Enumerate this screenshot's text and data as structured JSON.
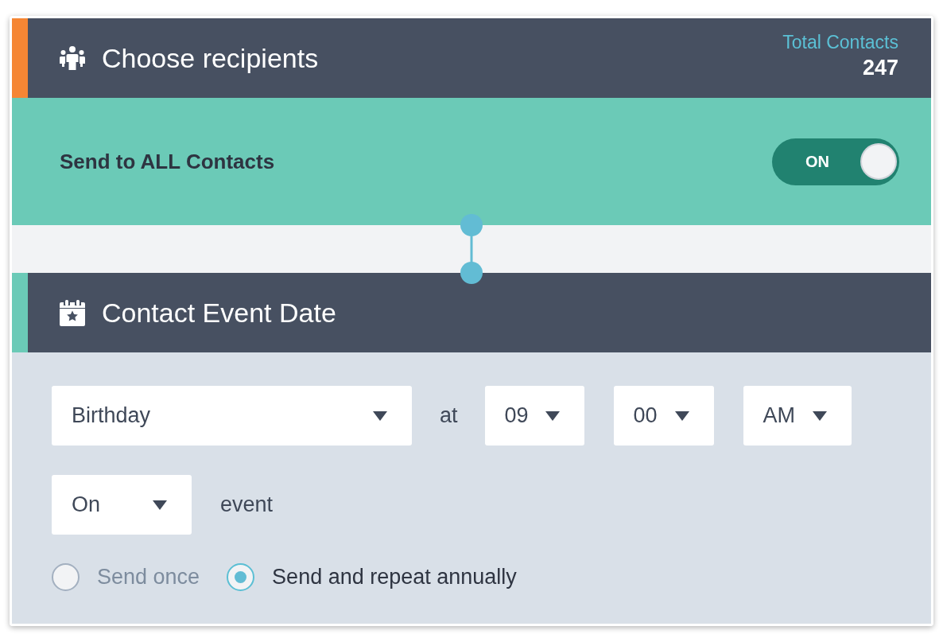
{
  "steps": [
    {
      "kind": "recipients",
      "title": "Choose recipients",
      "color": "#f58634",
      "total_label": "Total Contacts",
      "total_value": "247",
      "send_all": {
        "label": "Send to ALL Contacts",
        "on": true,
        "switch_text": "ON"
      }
    },
    {
      "kind": "event_date",
      "title": "Contact Event Date",
      "color": "#6bcab7",
      "event_type": "Birthday",
      "at_label": "at",
      "hour": "09",
      "minute": "00",
      "period": "AM",
      "timing": "On",
      "timing_label": "event",
      "repeat_options": [
        {
          "label": "Send once",
          "selected": false
        },
        {
          "label": "Send and repeat annually",
          "selected": true
        }
      ]
    }
  ]
}
